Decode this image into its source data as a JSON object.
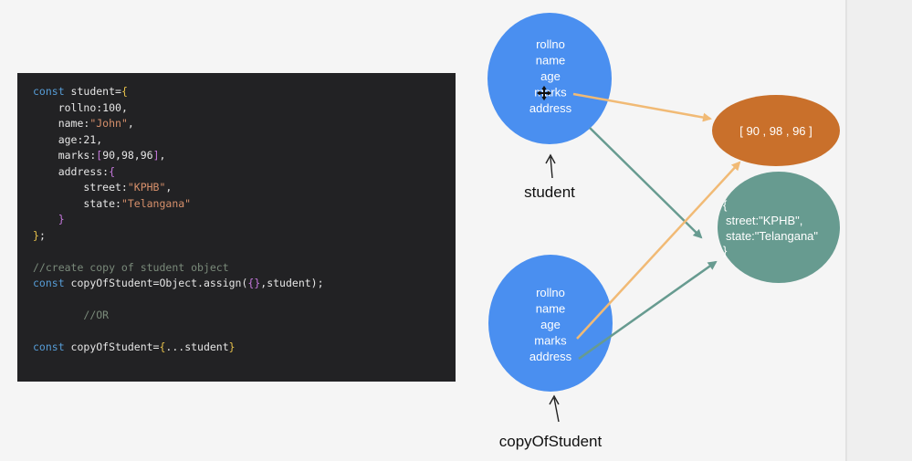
{
  "code": {
    "lines": [
      {
        "indent": "",
        "tokens": [
          {
            "t": "const ",
            "c": "kw"
          },
          {
            "t": "student",
            "c": "plain"
          },
          {
            "t": "=",
            "c": "plain"
          },
          {
            "t": "{",
            "c": "brace"
          }
        ]
      },
      {
        "indent": "    ",
        "tokens": [
          {
            "t": "rollno:100,",
            "c": "plain"
          }
        ]
      },
      {
        "indent": "    ",
        "tokens": [
          {
            "t": "name:",
            "c": "plain"
          },
          {
            "t": "\"John\"",
            "c": "str"
          },
          {
            "t": ",",
            "c": "plain"
          }
        ]
      },
      {
        "indent": "    ",
        "tokens": [
          {
            "t": "age:21,",
            "c": "plain"
          }
        ]
      },
      {
        "indent": "    ",
        "tokens": [
          {
            "t": "marks:",
            "c": "plain"
          },
          {
            "t": "[",
            "c": "brace2"
          },
          {
            "t": "90,98,96",
            "c": "plain"
          },
          {
            "t": "]",
            "c": "brace2"
          },
          {
            "t": ",",
            "c": "plain"
          }
        ]
      },
      {
        "indent": "    ",
        "tokens": [
          {
            "t": "address:",
            "c": "plain"
          },
          {
            "t": "{",
            "c": "brace2"
          }
        ]
      },
      {
        "indent": "        ",
        "tokens": [
          {
            "t": "street:",
            "c": "plain"
          },
          {
            "t": "\"KPHB\"",
            "c": "str"
          },
          {
            "t": ",",
            "c": "plain"
          }
        ]
      },
      {
        "indent": "        ",
        "tokens": [
          {
            "t": "state:",
            "c": "plain"
          },
          {
            "t": "\"Telangana\"",
            "c": "str"
          }
        ]
      },
      {
        "indent": "    ",
        "tokens": [
          {
            "t": "}",
            "c": "brace2"
          }
        ]
      },
      {
        "indent": "",
        "tokens": [
          {
            "t": "}",
            "c": "brace"
          },
          {
            "t": ";",
            "c": "plain"
          }
        ]
      },
      {
        "indent": "",
        "tokens": []
      },
      {
        "indent": "",
        "tokens": [
          {
            "t": "//create copy of student object",
            "c": "cmt"
          }
        ]
      },
      {
        "indent": "",
        "tokens": [
          {
            "t": "const ",
            "c": "kw"
          },
          {
            "t": "copyOfStudent=Object.assign(",
            "c": "plain"
          },
          {
            "t": "{}",
            "c": "brace2"
          },
          {
            "t": ",student);",
            "c": "plain"
          }
        ]
      },
      {
        "indent": "",
        "tokens": []
      },
      {
        "indent": "        ",
        "tokens": [
          {
            "t": "//OR",
            "c": "cmt"
          }
        ]
      },
      {
        "indent": "",
        "tokens": []
      },
      {
        "indent": "",
        "tokens": [
          {
            "t": "const ",
            "c": "kw"
          },
          {
            "t": "copyOfStudent=",
            "c": "plain"
          },
          {
            "t": "{",
            "c": "brace"
          },
          {
            "t": "...student",
            "c": "plain"
          },
          {
            "t": "}",
            "c": "brace"
          }
        ]
      }
    ]
  },
  "diagram": {
    "student_node": {
      "fields": [
        "rollno",
        "name",
        "age",
        "marks",
        "address"
      ],
      "label": "student"
    },
    "copy_node": {
      "fields": [
        "rollno",
        "name",
        "age",
        "marks",
        "address"
      ],
      "label": "copyOfStudent"
    },
    "marks_node": {
      "text": "[ 90 , 98 , 96 ]"
    },
    "address_node": {
      "lines": [
        "{",
        "street:\"KPHB\",",
        "state:\"Telangana\"",
        "}"
      ]
    },
    "colors": {
      "object_blue": "#4a8ff0",
      "marks_orange": "#c9702b",
      "address_teal": "#679b90",
      "arrow_orange": "#f1ba75",
      "arrow_teal": "#679b90"
    }
  }
}
